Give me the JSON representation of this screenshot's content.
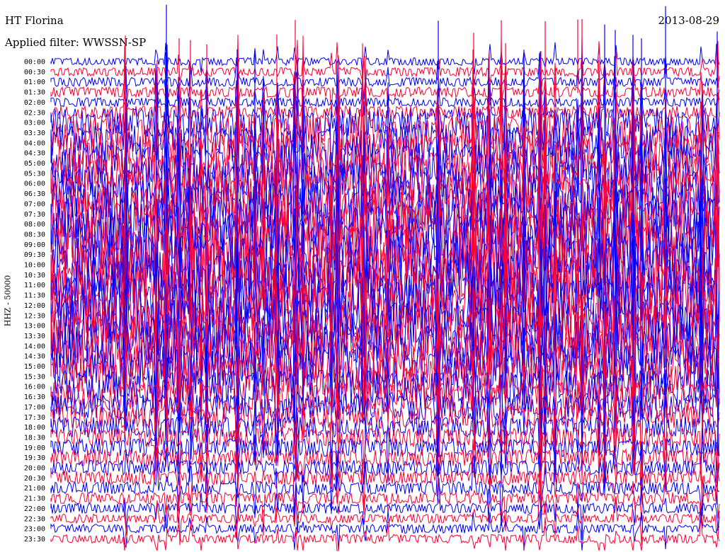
{
  "header": {
    "station": "HT Florina",
    "date": "2013-08-29",
    "filter": "Applied filter: WWSSN-SP"
  },
  "colors": {
    "trace_a": "#0000ff",
    "trace_b": "#ff0033"
  },
  "chart_data": {
    "type": "line",
    "title": "HT Florina",
    "subtitle": "Applied filter: WWSSN-SP",
    "ylabel": "HHZ - 50000",
    "xlabel": "",
    "grid": false,
    "legend": "none",
    "categories": [
      "00:00",
      "00:30",
      "01:00",
      "01:30",
      "02:00",
      "02:30",
      "03:00",
      "03:30",
      "04:00",
      "04:30",
      "05:00",
      "05:30",
      "06:00",
      "06:30",
      "07:00",
      "07:30",
      "08:00",
      "08:30",
      "09:00",
      "09:30",
      "10:00",
      "10:30",
      "11:00",
      "11:30",
      "12:00",
      "12:30",
      "13:00",
      "13:30",
      "14:00",
      "14:30",
      "15:00",
      "15:30",
      "16:00",
      "16:30",
      "17:00",
      "17:30",
      "18:00",
      "18:30",
      "19:00",
      "19:30",
      "20:00",
      "20:30",
      "21:00",
      "21:30",
      "22:00",
      "22:30",
      "23:00",
      "23:30"
    ],
    "relative_amplitude": [
      0.6,
      0.7,
      0.7,
      0.8,
      0.7,
      1.0,
      2.2,
      2.6,
      2.8,
      3.0,
      3.2,
      3.2,
      3.4,
      3.6,
      3.8,
      4.0,
      4.2,
      4.4,
      4.6,
      4.6,
      4.6,
      4.6,
      4.6,
      4.5,
      4.4,
      4.3,
      4.2,
      4.0,
      3.8,
      3.6,
      3.3,
      3.0,
      2.6,
      2.3,
      2.0,
      1.8,
      1.6,
      1.5,
      1.4,
      1.3,
      1.2,
      1.1,
      1.0,
      0.9,
      0.8,
      0.7,
      0.7,
      0.7
    ]
  }
}
